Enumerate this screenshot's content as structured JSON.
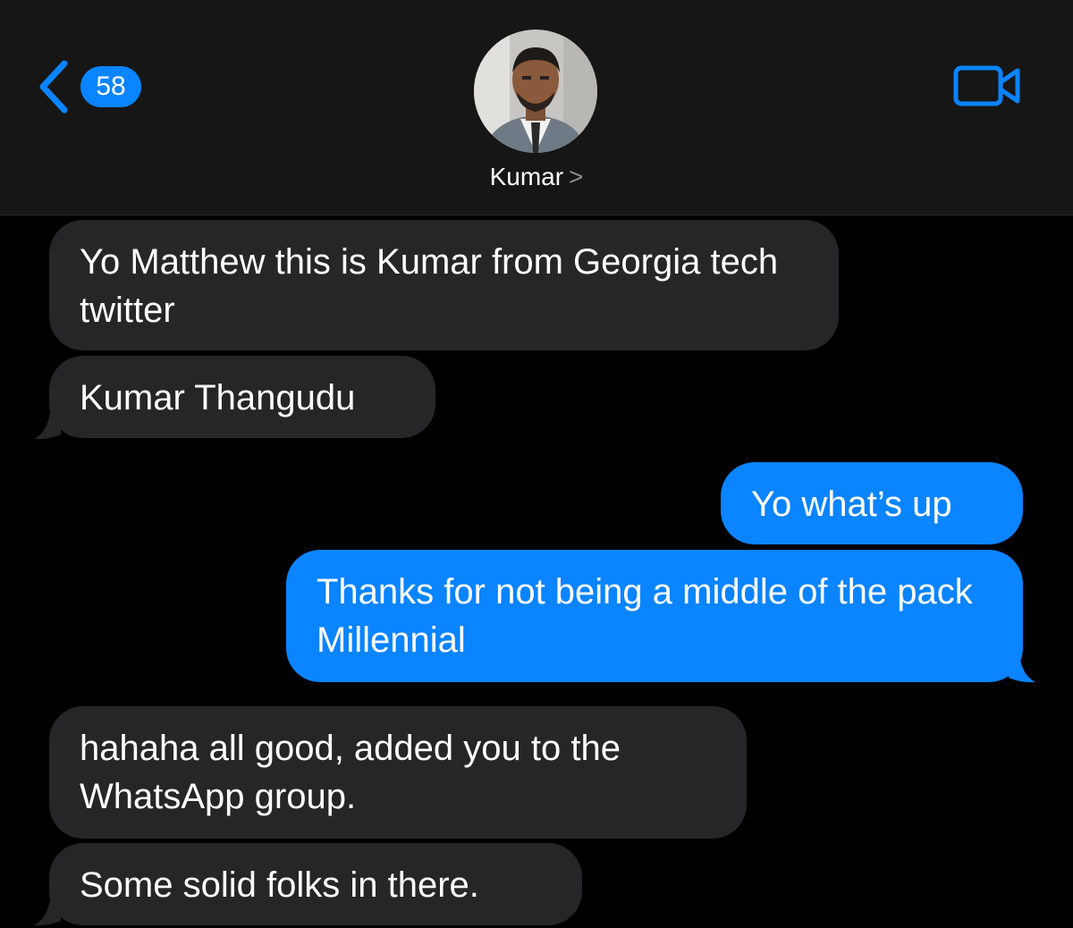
{
  "header": {
    "back_badge": "58",
    "contact_name": "Kumar",
    "name_chevron": ">"
  },
  "messages": [
    {
      "direction": "incoming",
      "text": "Yo Matthew this is Kumar from Georgia tech twitter"
    },
    {
      "direction": "incoming",
      "text": "Kumar Thangudu"
    },
    {
      "direction": "outgoing",
      "text": "Yo what’s up"
    },
    {
      "direction": "outgoing",
      "text": "Thanks for not being a middle of the pack Millennial"
    },
    {
      "direction": "incoming",
      "text": "hahaha all good, added you to the WhatsApp group."
    },
    {
      "direction": "incoming",
      "text": "Some solid folks in there."
    }
  ],
  "colors": {
    "accent": "#0a84ff",
    "incoming_bubble": "#262628",
    "header_bg": "#161616",
    "background": "#000000"
  },
  "icons": {
    "back": "chevron-left-icon",
    "video": "video-camera-icon"
  }
}
